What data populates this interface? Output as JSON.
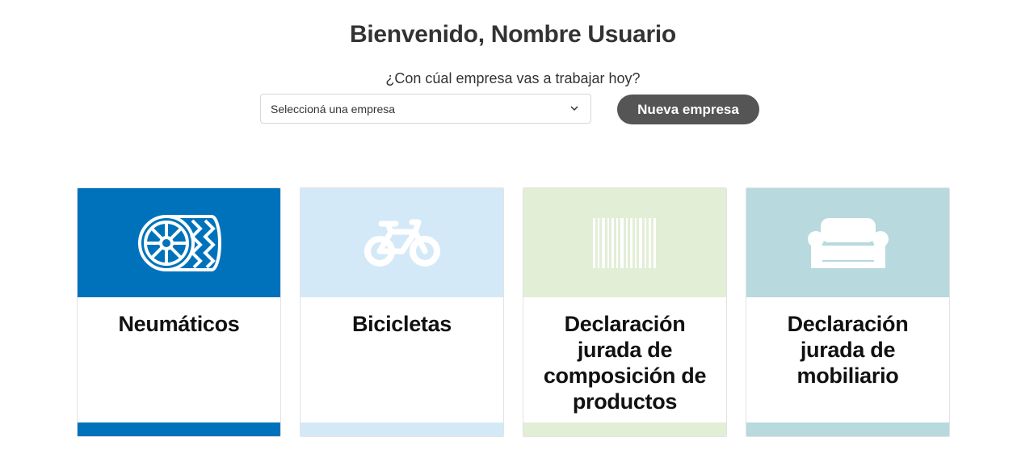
{
  "header": {
    "title": "Bienvenido, Nombre Usuario",
    "question": "¿Con cúal empresa vas a trabajar hoy?"
  },
  "company_select": {
    "value": "Seleccioná una empresa",
    "icon": "chevron-down-icon"
  },
  "new_company_button": "Nueva empresa",
  "cards": [
    {
      "label": "Neumáticos",
      "icon": "tire-icon",
      "top_color": "#0072bb",
      "bar_color": "#0072bb"
    },
    {
      "label": "Bicicletas",
      "icon": "bicycle-icon",
      "top_color": "#d4e9f8",
      "bar_color": "#d4e9f8"
    },
    {
      "label": "Declaración jurada de composición de productos",
      "icon": "barcode-icon",
      "top_color": "#e2eed6",
      "bar_color": "#e2eed6"
    },
    {
      "label": "Declaración jurada de mobiliario",
      "icon": "sofa-icon",
      "top_color": "#b8d9dd",
      "bar_color": "#b8d9dd"
    }
  ]
}
